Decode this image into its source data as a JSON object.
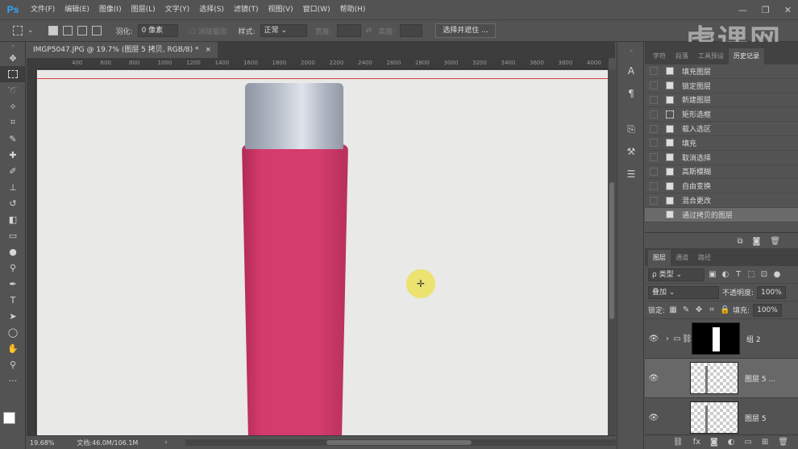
{
  "app": {
    "logo": "Ps"
  },
  "menu": [
    "文件(F)",
    "编辑(E)",
    "图像(I)",
    "图层(L)",
    "文字(Y)",
    "选择(S)",
    "滤镜(T)",
    "视图(V)",
    "窗口(W)",
    "帮助(H)"
  ],
  "window_controls": {
    "minimize": "—",
    "restore": "❐",
    "close": "✕"
  },
  "options": {
    "feather_label": "羽化:",
    "feather_value": "0 像素",
    "antialias_label": "消除锯齿",
    "style_label": "样式:",
    "style_value": "正常",
    "width_label": "宽度:",
    "height_label": "高度:",
    "select_mask_button": "选择并遮住 ..."
  },
  "brand_watermark": "虎课网",
  "document": {
    "tab_title": "IMGP5047.JPG @ 19.7% (图层 5 拷贝, RGB/8) *",
    "tab_close": "×",
    "zoom": "19.68%",
    "doc_size": "文档:46.0M/106.1M"
  },
  "ruler_ticks": [
    "400",
    "600",
    "800",
    "1000",
    "1200",
    "1400",
    "1600",
    "1800",
    "2000",
    "2200",
    "2400",
    "2600",
    "2800",
    "3000",
    "3200",
    "3400",
    "3600",
    "3800",
    "4000"
  ],
  "panels": {
    "top_tabs": [
      "字符",
      "段落",
      "工具预设",
      "历史记录"
    ],
    "history": [
      {
        "label": "填充图层",
        "icon": "doc-icon"
      },
      {
        "label": "锁定图层",
        "icon": "doc-icon"
      },
      {
        "label": "新建图层",
        "icon": "doc-icon"
      },
      {
        "label": "矩形选框",
        "icon": "marquee-icon"
      },
      {
        "label": "载入选区",
        "icon": "doc-icon"
      },
      {
        "label": "填充",
        "icon": "doc-icon"
      },
      {
        "label": "取消选择",
        "icon": "doc-icon"
      },
      {
        "label": "高斯模糊",
        "icon": "doc-icon"
      },
      {
        "label": "自由变换",
        "icon": "doc-icon"
      },
      {
        "label": "混合更改",
        "icon": "doc-icon"
      },
      {
        "label": "通过拷贝的图层",
        "icon": "doc-icon"
      }
    ],
    "layer_tabs": [
      "图层",
      "通道",
      "路径"
    ],
    "filter_kind": "ρ 类型",
    "blend_mode": "叠加",
    "opacity_label": "不透明度:",
    "opacity_value": "100%",
    "lock_label": "锁定:",
    "fill_label": "填充:",
    "fill_value": "100%",
    "layers": [
      {
        "name": "组 2",
        "type": "group",
        "selected": false
      },
      {
        "name": "图层 5 ...",
        "type": "layer",
        "selected": true
      },
      {
        "name": "图层 5",
        "type": "layer",
        "selected": false
      }
    ]
  },
  "colors": {
    "bottle_pink": "#d23b6c",
    "cap_gray": "#b3bac6",
    "canvas": "#e9e9e7",
    "ps_blue": "#31a8ff"
  }
}
